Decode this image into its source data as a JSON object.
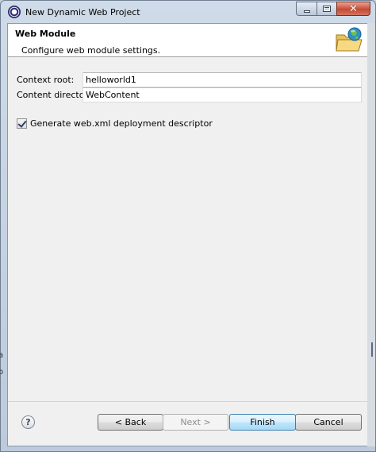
{
  "window": {
    "title": "New Dynamic Web Project",
    "controls": {
      "minimize_icon": "minimize-icon",
      "maximize_icon": "maximize-icon",
      "close_icon": "close-icon"
    }
  },
  "header": {
    "title": "Web Module",
    "description": "Configure web module settings.",
    "icon": "web-folder-icon"
  },
  "form": {
    "context_root": {
      "label": "Context root:",
      "value": "helloworld1"
    },
    "content_directory": {
      "label": "Content directory:",
      "value": "WebContent"
    },
    "generate_web_xml": {
      "label": "Generate web.xml deployment descriptor",
      "checked": true
    }
  },
  "footer": {
    "help_label": "?",
    "back_label": "< Back",
    "next_label": "Next >",
    "finish_label": "Finish",
    "cancel_label": "Cancel"
  },
  "background": {
    "fragment_1": "a",
    "fragment_2": "o"
  },
  "colors": {
    "finish_accent": "#a7d9f5",
    "titlebar": "#bccadb",
    "close_button": "#c64a35"
  }
}
